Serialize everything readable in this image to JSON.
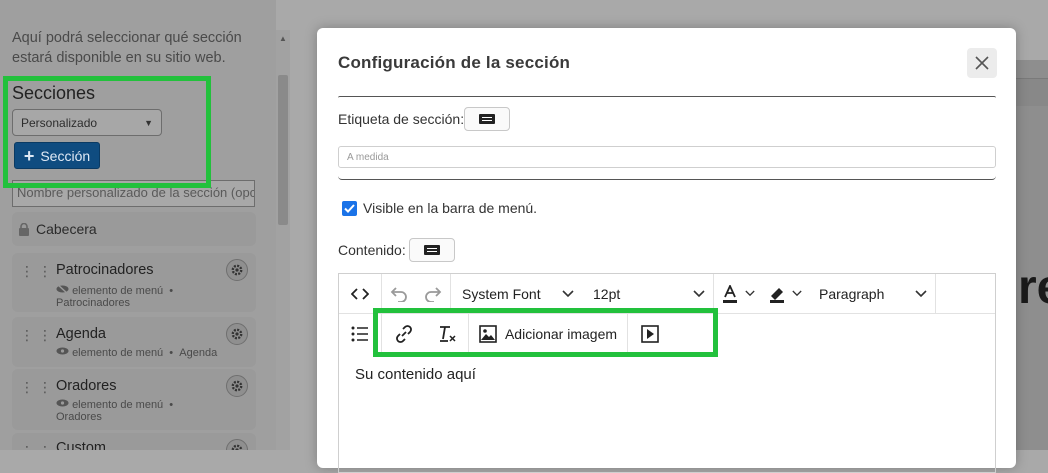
{
  "sidebar": {
    "intro_text": "Aquí podrá seleccionar qué sección estará disponible en su sitio web.",
    "sections_title": "Secciones",
    "mode_select": {
      "value": "Personalizado"
    },
    "add_section_label": "Sección",
    "custom_name_placeholder": "Nombre personalizado de la sección (opc",
    "header_card": "Cabecera",
    "cards": [
      {
        "name": "Patrocinadores",
        "meta": "elemento de menú",
        "sub": "Patrocinadores"
      },
      {
        "name": "Agenda",
        "meta": "elemento de menú",
        "sub": "Agenda"
      },
      {
        "name": "Oradores",
        "meta": "elemento de menú",
        "sub": "Oradores"
      },
      {
        "name": "Custom",
        "meta": "",
        "sub": ""
      }
    ]
  },
  "modal": {
    "title": "Configuración de la sección",
    "section_label_text": "Etiqueta de sección:",
    "section_field_placeholder": "A medida",
    "visible_checkbox_label": "Visible en la barra de menú.",
    "visible_checked": true,
    "content_label": "Contenido:",
    "editor": {
      "font_family": "System Font",
      "font_size": "12pt",
      "block_format": "Paragraph",
      "add_image_label": "Adicionar imagem",
      "content": "Su contenido aquí"
    }
  },
  "colors": {
    "primary_button": "#0f4c80",
    "highlight": "#22c13c",
    "checkbox": "#1a73e8"
  }
}
